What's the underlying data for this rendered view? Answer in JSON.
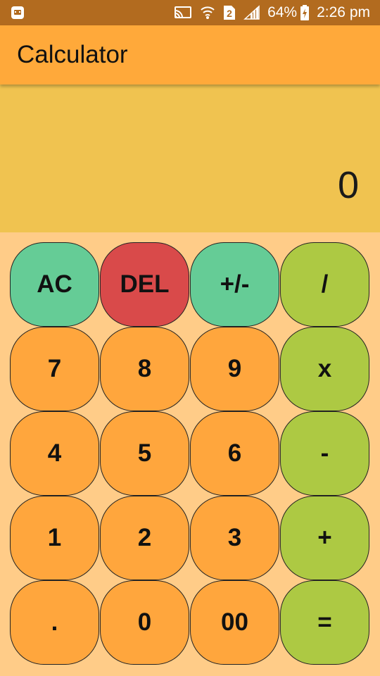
{
  "status_bar": {
    "battery": "64%",
    "time": "2:26 pm",
    "sim_slot": "2",
    "icons": [
      "app-notification-icon",
      "cast-icon",
      "wifi-icon",
      "sim-icon",
      "signal-icon",
      "battery-charging-icon"
    ]
  },
  "app_bar": {
    "title": "Calculator"
  },
  "display": {
    "value": "0"
  },
  "keypad": {
    "keys": [
      {
        "label": "AC",
        "kind": "func"
      },
      {
        "label": "DEL",
        "kind": "del"
      },
      {
        "label": "+/-",
        "kind": "func"
      },
      {
        "label": "/",
        "kind": "op"
      },
      {
        "label": "7",
        "kind": "num"
      },
      {
        "label": "8",
        "kind": "num"
      },
      {
        "label": "9",
        "kind": "num"
      },
      {
        "label": "x",
        "kind": "op"
      },
      {
        "label": "4",
        "kind": "num"
      },
      {
        "label": "5",
        "kind": "num"
      },
      {
        "label": "6",
        "kind": "num"
      },
      {
        "label": "-",
        "kind": "op"
      },
      {
        "label": "1",
        "kind": "num"
      },
      {
        "label": "2",
        "kind": "num"
      },
      {
        "label": "3",
        "kind": "num"
      },
      {
        "label": "+",
        "kind": "op"
      },
      {
        "label": ".",
        "kind": "num"
      },
      {
        "label": "0",
        "kind": "num"
      },
      {
        "label": "00",
        "kind": "num"
      },
      {
        "label": "=",
        "kind": "op"
      }
    ]
  },
  "colors": {
    "status_bar": "#b26b1f",
    "app_bar": "#ffa93a",
    "display_bg": "#f0c350",
    "keypad_bg": "#ffcc88",
    "number_key": "#ffa63d",
    "function_key": "#65cc96",
    "delete_key": "#d94a4a",
    "operator_key": "#adc943"
  }
}
